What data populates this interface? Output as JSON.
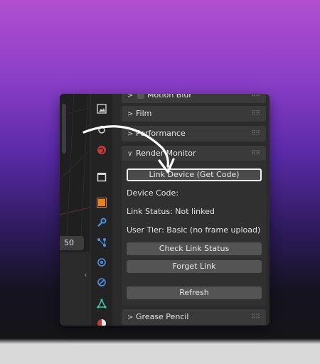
{
  "viewport": {
    "frame_value": "50"
  },
  "sections": {
    "motion_blur": "Motion Blur",
    "film": "Film",
    "performance": "Performance",
    "render_monitor": "Render Monitor",
    "grease_pencil": "Grease Pencil"
  },
  "render_monitor": {
    "link_button": "Link Device (Get Code)",
    "device_code_label": "Device Code:",
    "link_status": "Link Status: Not linked",
    "user_tier": "User Tier: Basic (no frame upload)",
    "check_button": "Check Link Status",
    "forget_button": "Forget Link",
    "refresh_button": "Refresh"
  },
  "colors": {
    "bg_top": "#b24fd0",
    "bg_bottom": "#151518",
    "panel_bg": "#2b2b2b",
    "accent_orange": "#e0832a",
    "accent_blue": "#4f8fe0",
    "accent_teal": "#3cc8a8"
  }
}
